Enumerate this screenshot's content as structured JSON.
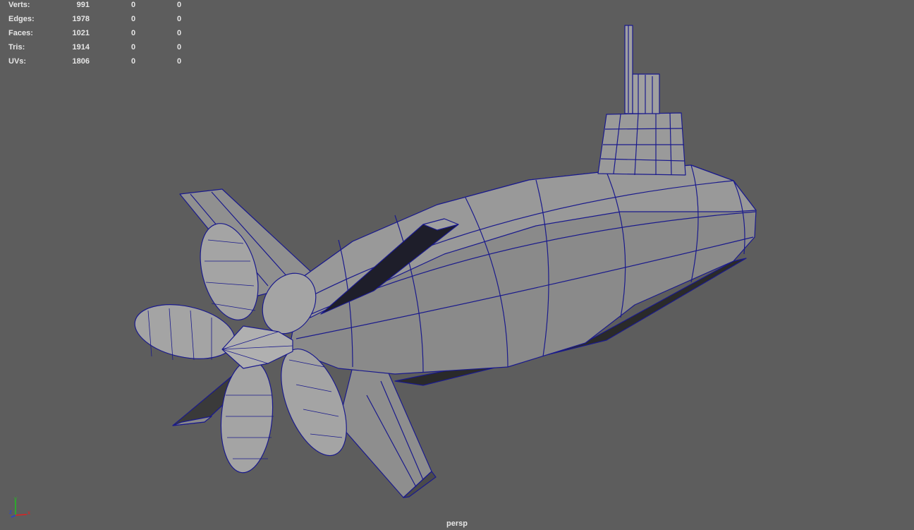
{
  "hud": {
    "rows": [
      {
        "label": "Verts:",
        "values": [
          "991",
          "0",
          "0"
        ]
      },
      {
        "label": "Edges:",
        "values": [
          "1978",
          "0",
          "0"
        ]
      },
      {
        "label": "Faces:",
        "values": [
          "1021",
          "0",
          "0"
        ]
      },
      {
        "label": "Tris:",
        "values": [
          "1914",
          "0",
          "0"
        ]
      },
      {
        "label": "UVs:",
        "values": [
          "1806",
          "0",
          "0"
        ]
      }
    ]
  },
  "camera_label": "persp",
  "axis": {
    "x": "x",
    "y": "y",
    "z": "z"
  },
  "colors": {
    "background": "#5d5d5d",
    "wire": "#1a1a8c",
    "mesh": "#8c8c8c",
    "x_axis": "#e02020",
    "y_axis": "#20c020",
    "z_axis": "#2040e0"
  }
}
